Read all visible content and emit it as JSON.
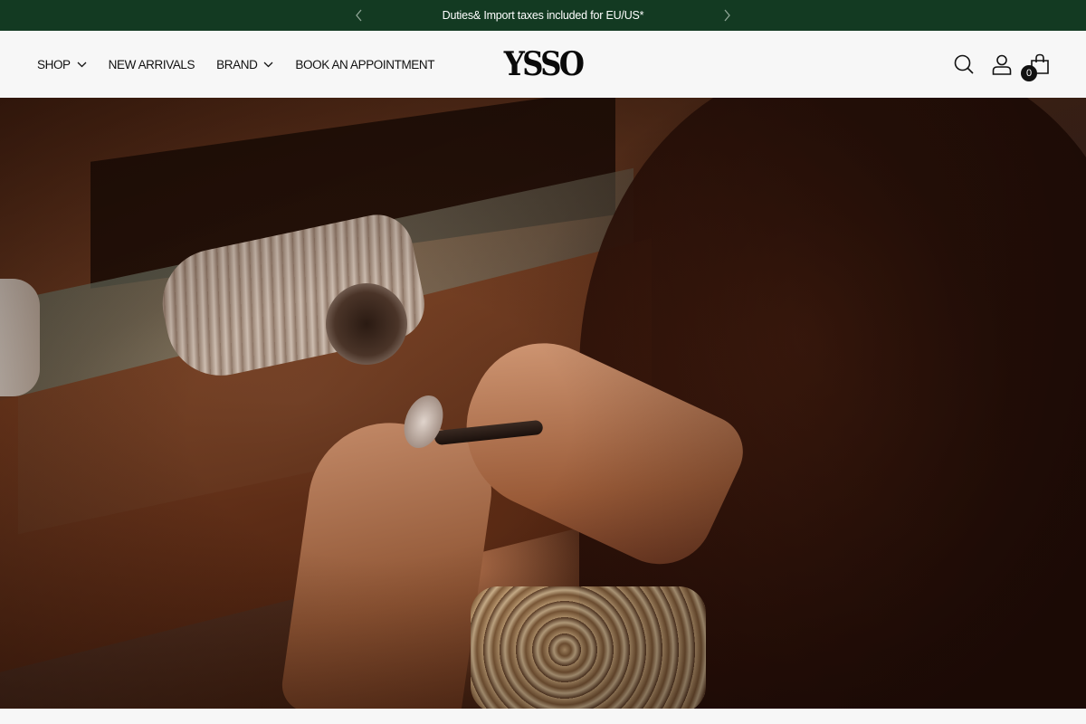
{
  "announcement": {
    "text": "Duties& Import taxes included for EU/US*",
    "background": "#133a22"
  },
  "nav": {
    "items": [
      {
        "label": "SHOP",
        "has_dropdown": true
      },
      {
        "label": "NEW ARRIVALS",
        "has_dropdown": false
      },
      {
        "label": "BRAND",
        "has_dropdown": true
      },
      {
        "label": "BOOK AN APPOINTMENT",
        "has_dropdown": false
      }
    ]
  },
  "logo": {
    "text": "YSSO"
  },
  "header_icons": [
    "search-icon",
    "account-icon",
    "cart-icon"
  ],
  "cart": {
    "count": "0"
  },
  "hero": {
    "description_icon": "jeweler-workbench-photo"
  }
}
